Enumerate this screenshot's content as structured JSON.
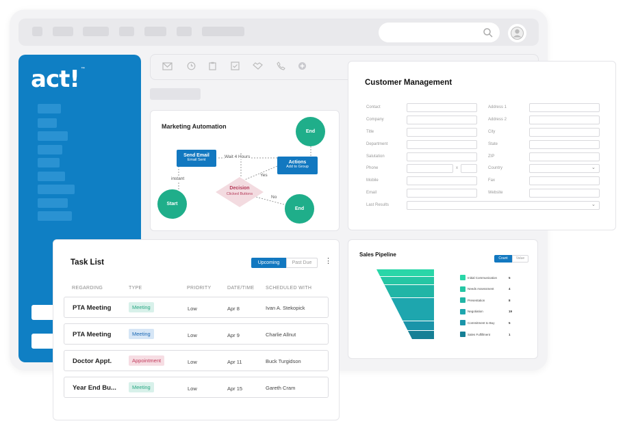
{
  "brand": {
    "logo_text": "act!",
    "logo_tm": "™"
  },
  "toolbar_icons": [
    "mail-icon",
    "clock-icon",
    "clipboard-icon",
    "checkbox-icon",
    "handshake-icon",
    "phone-icon",
    "plus-circle-icon"
  ],
  "marketing_automation": {
    "title": "Marketing Automation",
    "send_email": {
      "title": "Send Email",
      "subtitle": "Email Sent"
    },
    "actions": {
      "title": "Actions",
      "subtitle": "Add to Group"
    },
    "decision": {
      "title": "Decision",
      "subtitle": "Clicked Buttons"
    },
    "start_label": "Start",
    "end_label": "End",
    "wait_label": "Wait 4 Hours",
    "instant_label": "instant",
    "yes_label": "Yes",
    "no_label": "No",
    "colors": {
      "box": "#1278c0",
      "circle": "#1fae8a",
      "decision": "#f3dbe0"
    }
  },
  "customer_management": {
    "title": "Customer Management",
    "left_fields": [
      "Contact",
      "Company",
      "Title",
      "Department",
      "Salutation",
      "Phone",
      "Mobile",
      "Email",
      "Last Results"
    ],
    "right_fields": [
      "Address 1",
      "Address 2",
      "City",
      "State",
      "ZIP",
      "Country",
      "Fax",
      "Website"
    ],
    "phone_ext_label": "x"
  },
  "task_list": {
    "title": "Task List",
    "tab_upcoming": "Upcoming",
    "tab_past_due": "Past Due",
    "columns": [
      "REGARDING",
      "TYPE",
      "PRIORITY",
      "DATE/TIME",
      "SCHEDULED WITH"
    ],
    "rows": [
      {
        "regarding": "PTA Meeting",
        "type": "Meeting",
        "type_style": "green",
        "priority": "Low",
        "date": "Apr 8",
        "with": "Ivan A. Stekopick"
      },
      {
        "regarding": "PTA Meeting",
        "type": "Meeting",
        "type_style": "blue",
        "priority": "Low",
        "date": "Apr 9",
        "with": "Charlie Allnut"
      },
      {
        "regarding": "Doctor Appt.",
        "type": "Appointment",
        "type_style": "red",
        "priority": "Low",
        "date": "Apr 11",
        "with": "Buck Turgidson"
      },
      {
        "regarding": "Year End Bu...",
        "type": "Meeting",
        "type_style": "green",
        "priority": "Low",
        "date": "Apr 15",
        "with": "Gareth Cram"
      }
    ]
  },
  "sales_pipeline": {
    "title": "Sales Pipeline",
    "toggle_count": "Count",
    "toggle_value": "Value",
    "stages": [
      {
        "name": "Initial Communication",
        "count": "5",
        "color": "#29d6a8"
      },
      {
        "name": "Needs Assessment",
        "count": "4",
        "color": "#25c6a4"
      },
      {
        "name": "Presentation",
        "count": "8",
        "color": "#21b5a6"
      },
      {
        "name": "Negotiation",
        "count": "19",
        "color": "#1ea6ae"
      },
      {
        "name": "Commitment to Buy",
        "count": "5",
        "color": "#1a94a9"
      },
      {
        "name": "Sales Fulfillment",
        "count": "1",
        "color": "#157f95"
      }
    ]
  }
}
